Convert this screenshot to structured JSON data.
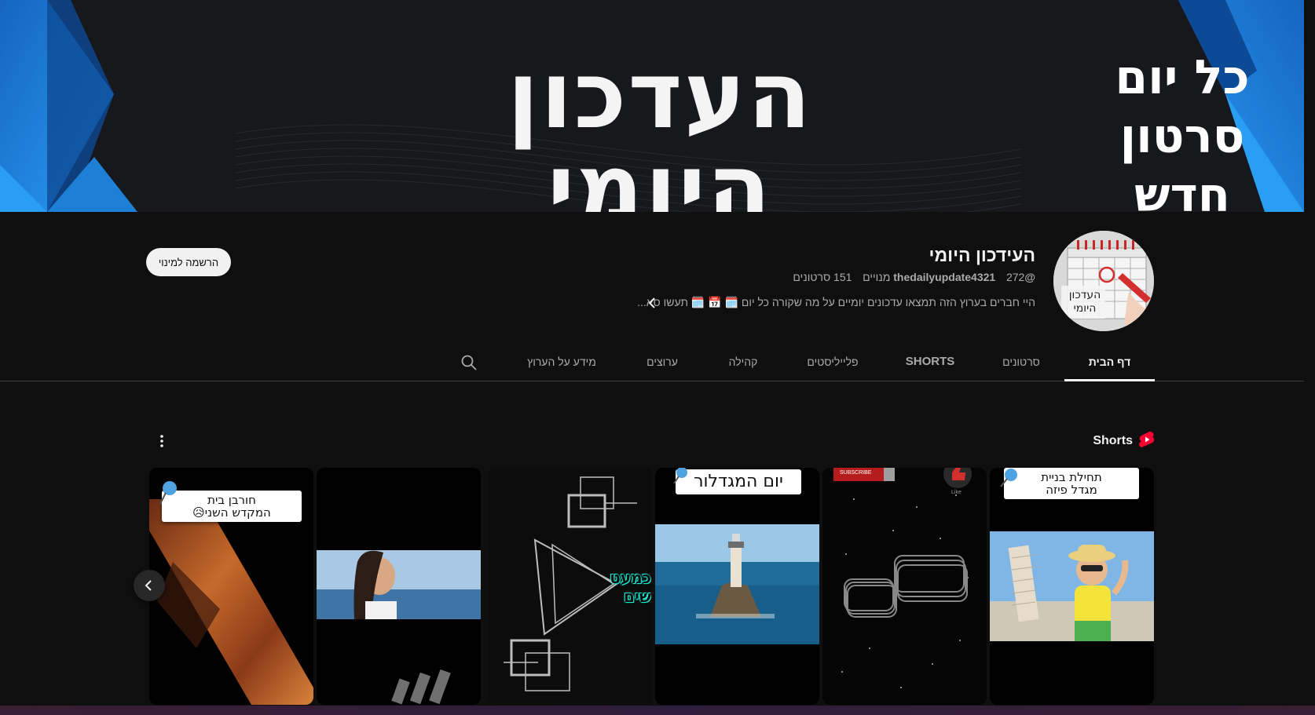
{
  "banner": {
    "title": "העדכון היומי",
    "slogan_line1": "כל יום",
    "slogan_line2": "סרטון חדש"
  },
  "channel": {
    "avatar_text_line1": "העדכון",
    "avatar_text_line2": "היומי",
    "name": "העידכון היומי",
    "handle": "@thedailyupdate4321",
    "subscribers": "272 מנויים",
    "videos": "151 סרטונים",
    "description": "היי חברים בערוץ הזה תמצאו עדכונים יומיים על מה שקורה כל יום 🗓️ 📅 🗓️ תעשו סא...",
    "subscribe_label": "הרשמה למינוי"
  },
  "tabs": [
    {
      "label": "דף הבית",
      "active": true
    },
    {
      "label": "סרטונים"
    },
    {
      "label": "SHORTS"
    },
    {
      "label": "פלייליסטים"
    },
    {
      "label": "קהילה"
    },
    {
      "label": "ערוצים"
    },
    {
      "label": "מידע על הערוץ"
    }
  ],
  "shorts": {
    "title": "Shorts",
    "items": [
      {
        "label_line1": "תחילת בניית",
        "label_line2": "מגדל פיזה"
      },
      {
        "label_line1": "SUBSCRIBE",
        "label_line2": "Like"
      },
      {
        "label_line1": "יום המגדלור"
      },
      {
        "label_line1": "כמעט",
        "label_line2": "שים"
      },
      {},
      {
        "label_line1": "חורבן בית",
        "label_line2": "המקדש השני😥"
      }
    ]
  },
  "colors": {
    "background": "#0f0f0f",
    "accent_blue": "#1f8ae0",
    "shorts_red": "#ff0033"
  }
}
